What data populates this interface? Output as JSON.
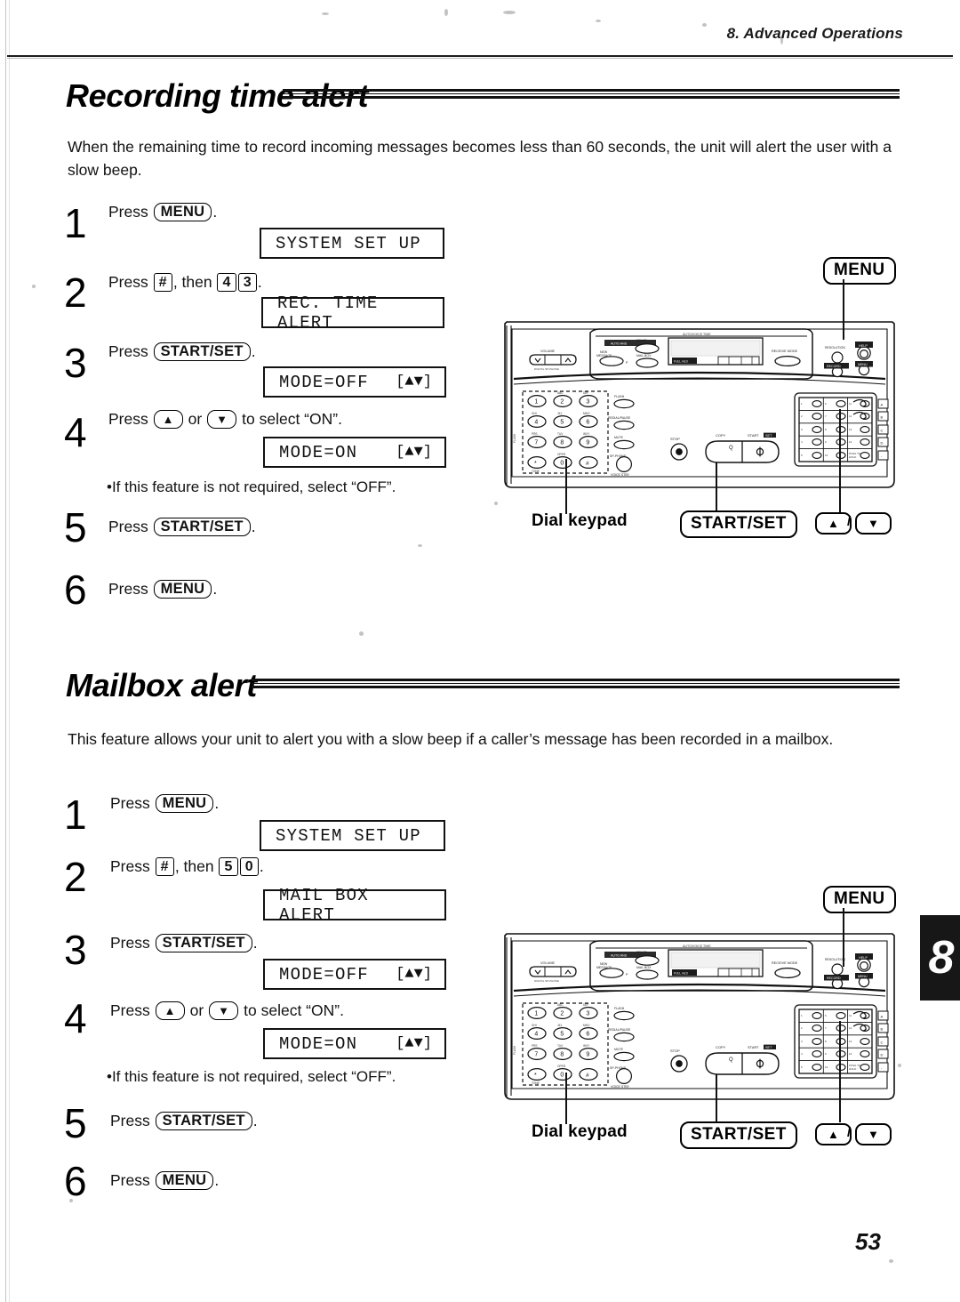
{
  "header": {
    "running_head": "8.  Advanced Operations"
  },
  "page": {
    "folio": "53",
    "chapter_tab": "8"
  },
  "sections": [
    {
      "id": "recording-time-alert",
      "title": "Recording time alert",
      "intro": "When the remaining time to record incoming messages becomes less than 60 seconds, the unit will alert the user with a slow beep.",
      "steps": [
        {
          "num": "1",
          "text_before": "Press",
          "key": "MENU",
          "text_after": "."
        },
        {
          "num": "2",
          "text_before": "Press",
          "key": "#",
          "text_mid": ", then",
          "key2": "4",
          "key3": "3",
          "text_after": "."
        },
        {
          "num": "3",
          "text_before": "Press",
          "key": "START/SET",
          "text_after": "."
        },
        {
          "num": "4",
          "text_before": "Press",
          "key": "▲",
          "text_mid": "or",
          "key2": "▼",
          "text_after": "to select “ON”."
        },
        {
          "num": "5",
          "text_before": "Press",
          "key": "START/SET",
          "text_after": "."
        },
        {
          "num": "6",
          "text_before": "Press",
          "key": "MENU",
          "text_after": "."
        }
      ],
      "lcds": [
        {
          "left": "SYSTEM SET UP",
          "right": ""
        },
        {
          "left": "REC. TIME ALERT",
          "right": ""
        },
        {
          "left": "MODE=OFF",
          "right": "[▲▼]"
        },
        {
          "left": "MODE=ON",
          "right": "[▲▼]"
        }
      ],
      "note": "•If this feature is not required, select “OFF”."
    },
    {
      "id": "mailbox-alert",
      "title": "Mailbox alert",
      "intro": "This feature allows your unit to alert you with a slow beep if a caller’s message has been recorded in a mailbox.",
      "steps": [
        {
          "num": "1",
          "text_before": "Press",
          "key": "MENU",
          "text_after": "."
        },
        {
          "num": "2",
          "text_before": "Press",
          "key": "#",
          "text_mid": ", then",
          "key2": "5",
          "key3": "0",
          "text_after": "."
        },
        {
          "num": "3",
          "text_before": "Press",
          "key": "START/SET",
          "text_after": "."
        },
        {
          "num": "4",
          "text_before": "Press",
          "key": "▲",
          "text_mid": "or",
          "key2": "▼",
          "text_after": "to select “ON”."
        },
        {
          "num": "5",
          "text_before": "Press",
          "key": "START/SET",
          "text_after": "."
        },
        {
          "num": "6",
          "text_before": "Press",
          "key": "MENU",
          "text_after": "."
        }
      ],
      "lcds": [
        {
          "left": "SYSTEM SET UP",
          "right": ""
        },
        {
          "left": "MAIL BOX ALERT",
          "right": ""
        },
        {
          "left": "MODE=OFF",
          "right": "[▲▼]"
        },
        {
          "left": "MODE=ON",
          "right": "[▲▼]"
        }
      ],
      "note": "•If this feature is not required, select “OFF”."
    }
  ],
  "diagram": {
    "callout_menu": "MENU",
    "callout_dial_keypad": "Dial keypad",
    "callout_start_set": "START/SET",
    "callout_up": "▲",
    "callout_down": "▼",
    "callout_slash": "/",
    "panel_labels": {
      "volume": "VOLUME",
      "erase": "ERASE",
      "new_message": "NEW MESSAGE",
      "mail_box": "MAIL BOX",
      "receive_mode": "RECEIVE MODE",
      "resolution": "RESOLUTION",
      "help": "HELP",
      "redial_pause": "REDIAL/PAUSE",
      "mute": "MUTE",
      "sp_phone": "SP-PHONE",
      "stop": "STOP",
      "copy": "COPY",
      "start_set": "START/SET",
      "flash": "FLASH",
      "tone": "TONE",
      "voice_stby": "VOICE STBY"
    },
    "keypad_keys": [
      "1",
      "2",
      "3",
      "4",
      "5",
      "6",
      "7",
      "8",
      "9",
      "*",
      "0",
      "#"
    ],
    "keypad_letters": [
      "",
      "ABC",
      "DEF",
      "GHI",
      "JKL",
      "MNO",
      "PRS",
      "TUV",
      "WXY",
      "",
      "OPER",
      ""
    ]
  }
}
